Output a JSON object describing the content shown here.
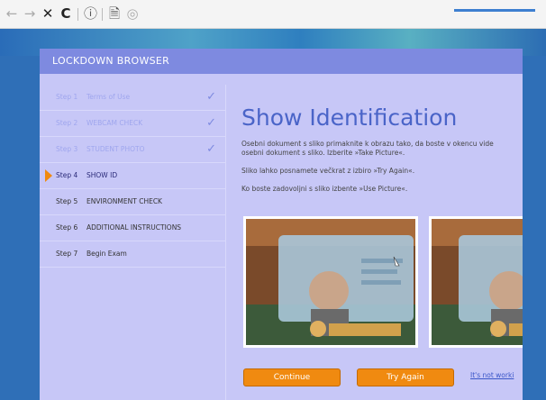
{
  "toolbar": {
    "back_icon": "←",
    "forward_icon": "→",
    "close_icon": "✕",
    "reload_icon": "C",
    "info_icon": "ⓘ",
    "page_icon": "🗎",
    "extension_icon": "◎"
  },
  "window": {
    "title": "LOCKDOWN BROWSER"
  },
  "steps": [
    {
      "num": "Step 1",
      "label": "Terms of Use",
      "status": "done"
    },
    {
      "num": "Step 2",
      "label": "WEBCAM CHECK",
      "status": "done"
    },
    {
      "num": "Step 3",
      "label": "STUDENT PHOTO",
      "status": "done"
    },
    {
      "num": "Step 4",
      "label": "SHOW ID",
      "status": "current"
    },
    {
      "num": "Step 5",
      "label": "ENVIRONMENT CHECK",
      "status": "pending"
    },
    {
      "num": "Step 6",
      "label": "ADDITIONAL INSTRUCTIONS",
      "status": "pending"
    },
    {
      "num": "Step 7",
      "label": "Begin Exam",
      "status": "pending"
    }
  ],
  "check_glyph": "✓",
  "content": {
    "heading": "Show Identification",
    "para1_line1": "Osebni dokument s sliko primaknite k obrazu tako, da boste v okencu vide",
    "para1_line2": "osebni dokument s sliko. Izberite »Take Picture«.",
    "para2": "Sliko lahko posnamete večkrat z izbiro »Try Again«.",
    "para3": "Ko boste zadovoljni s sliko izbente »Use Picture«.",
    "continue_label": "Continue",
    "try_again_label": "Try Again",
    "help_link": "It's not worki"
  },
  "colors": {
    "accent": "#f08a10",
    "titlebar": "#7e8ae0",
    "heading": "#4a64c8"
  }
}
